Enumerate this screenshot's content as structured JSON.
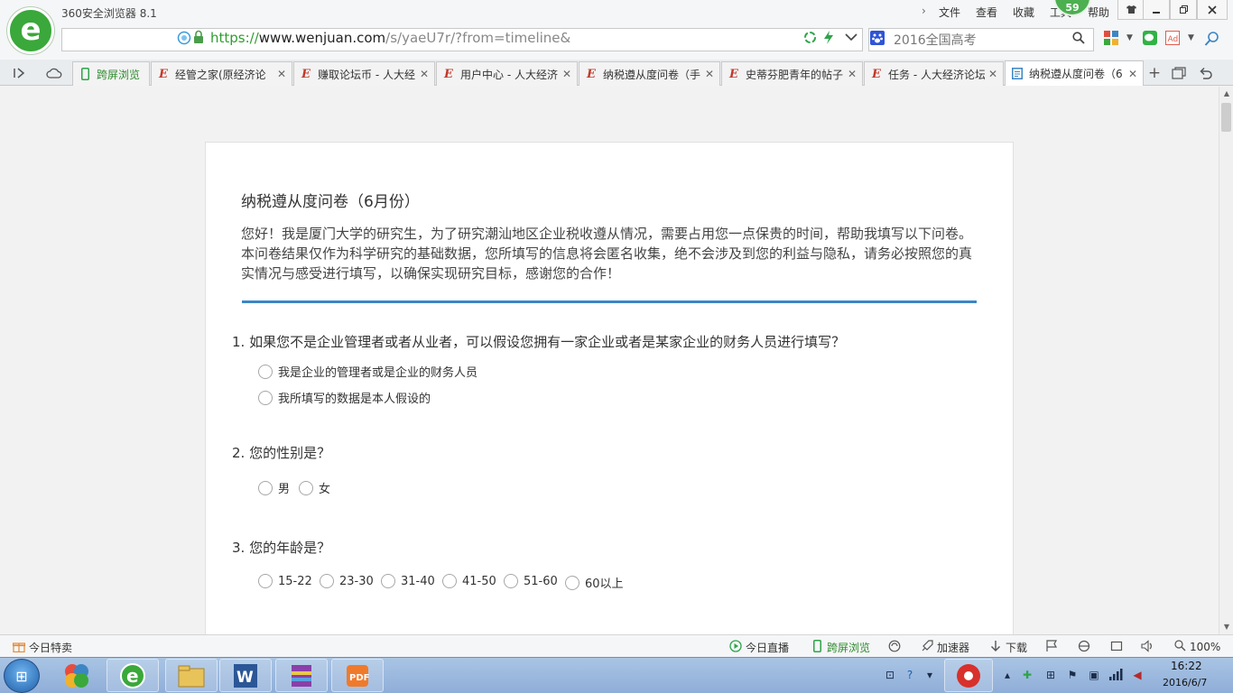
{
  "browser": {
    "app_title": "360安全浏览器 8.1",
    "menu": [
      "文件",
      "查看",
      "收藏",
      "工具",
      "帮助"
    ],
    "badge": "59",
    "window_buttons": [
      "minimize-icon",
      "restore-icon",
      "close-icon"
    ],
    "url": {
      "scheme": "https://",
      "host": "www.wenjuan.com",
      "path": "/s/yaeU7r/?from=timeline&"
    },
    "search": {
      "text": "2016全国高考",
      "engine_icon": "paw-icon"
    }
  },
  "tabs": [
    {
      "label": "跨屏浏览",
      "icon": "phone-icon",
      "closable": false
    },
    {
      "label": "经管之家(原经济论",
      "icon": "E"
    },
    {
      "label": "赚取论坛币 - 人大经",
      "icon": "E"
    },
    {
      "label": "用户中心 - 人大经济",
      "icon": "E"
    },
    {
      "label": "纳税遵从度问卷（手",
      "icon": "E"
    },
    {
      "label": "史蒂芬肥青年的帖子",
      "icon": "E"
    },
    {
      "label": "任务 - 人大经济论坛",
      "icon": "E"
    },
    {
      "label": "纳税遵从度问卷（6",
      "icon": "doc",
      "active": true
    }
  ],
  "survey": {
    "title": "纳税遵从度问卷（6月份）",
    "intro": "您好！我是厦门大学的研究生，为了研究潮汕地区企业税收遵从情况，需要占用您一点保贵的时间，帮助我填写以下问卷。本问卷结果仅作为科学研究的基础数据，您所填写的信息将会匿名收集，绝不会涉及到您的利益与隐私，请务必按照您的真实情况与感受进行填写，以确保实现研究目标，感谢您的合作！",
    "questions": [
      {
        "title": "1. 如果您不是企业管理者或者从业者，可以假设您拥有一家企业或者是某家企业的财务人员进行填写？",
        "options": [
          "我是企业的管理者或是企业的财务人员",
          "我所填写的数据是本人假设的"
        ]
      },
      {
        "title": "2. 您的性别是？",
        "options": [
          "男",
          "女"
        ]
      },
      {
        "title": "3. 您的年龄是？",
        "options": [
          "15-22",
          "23-30",
          "31-40",
          "41-50",
          "51-60",
          "60以上"
        ]
      }
    ]
  },
  "statusbar": {
    "left": "今日特卖",
    "right": [
      "今日直播",
      "跨屏浏览",
      "加速器",
      "下载"
    ],
    "zoom": "100%"
  },
  "taskbar": {
    "clock_time": "16:22",
    "clock_date": "2016/6/7"
  },
  "colors": {
    "accent_blue": "#3c86c4",
    "brand_green": "#3aa83a",
    "tab_icon_red": "#c0392b"
  }
}
